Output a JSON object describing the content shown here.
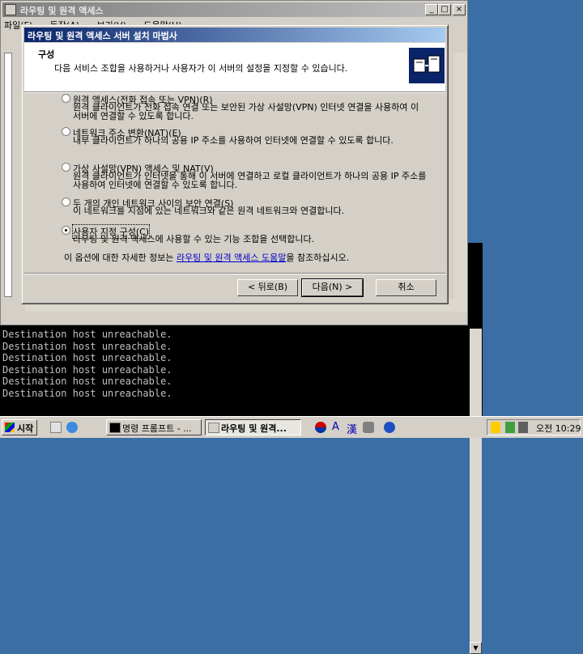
{
  "mmc": {
    "title": "라우팅 및 원격 액세스",
    "menu": [
      "파일(F)",
      "동작(A)",
      "보기(V)",
      "도움말(H)"
    ]
  },
  "console": {
    "lines": [
      "Destination host unreachable.",
      "Destination host unreachable.",
      "Destination host unreachable.",
      "Destination host unreachable.",
      "Destination host unreachable.",
      "Destination host unreachable."
    ]
  },
  "wizard": {
    "title": "라우팅 및 원격 액세스 서버 설치 마법사",
    "heading": "구성",
    "subtitle": "다음 서비스 조합을 사용하거나 사용자가 이 서버의 설정을 지정할 수 있습니다.",
    "options": [
      {
        "label": "원격 액세스(전화 접속 또는 VPN)(R)",
        "desc": "원격 클라이언트가 전화 접속 연결 또는 보안된 가상 사설망(VPN) 인터넷 연결을 사용하여 이 서버에 연결할 수 있도록 합니다.",
        "selected": false
      },
      {
        "label": "네트워크 주소 변환(NAT)(E)",
        "desc": "내부 클라이언트가 하나의 공용 IP 주소를 사용하여 인터넷에 연결할 수 있도록 합니다.",
        "selected": false
      },
      {
        "label": "가상 사설망(VPN) 액세스 및 NAT(V)",
        "desc": "원격 클라이언트가 인터넷을 통해 이 서버에 연결하고 로컬 클라이언트가 하나의 공용 IP 주소를 사용하여 인터넷에 연결할 수 있도록 합니다.",
        "selected": false
      },
      {
        "label": "두 개의 개인 네트워크 사이의 보안 연결(S)",
        "desc": "이 네트워크를 지점에 있는 네트워크와 같은 원격 네트워크와 연결합니다.",
        "selected": false
      },
      {
        "label": "사용자 지정 구성(C)",
        "desc": "라우팅 및 원격 액세스에 사용할 수 있는 기능 조합을 선택합니다.",
        "selected": true
      }
    ],
    "info_prefix": "이 옵션에 대한 자세한 정보는 ",
    "info_link": "라우팅 및 원격 액세스 도움말",
    "info_suffix": "을 참조하십시오.",
    "buttons": {
      "back": "< 뒤로(B)",
      "next": "다음(N) >",
      "cancel": "취소"
    }
  },
  "taskbar": {
    "start": "시작",
    "tasks": [
      {
        "label": "명령 프롬프트 - ...",
        "active": false
      },
      {
        "label": "라우팅 및 원격...",
        "active": true
      }
    ],
    "ime": {
      "lang": "A",
      "hanja": "漢"
    },
    "clock": "오전 10:29"
  },
  "colors": {
    "desktop": "#3a6ea5",
    "title_active_start": "#0a246a",
    "title_active_end": "#a6caf0",
    "face": "#d4d0c8"
  }
}
